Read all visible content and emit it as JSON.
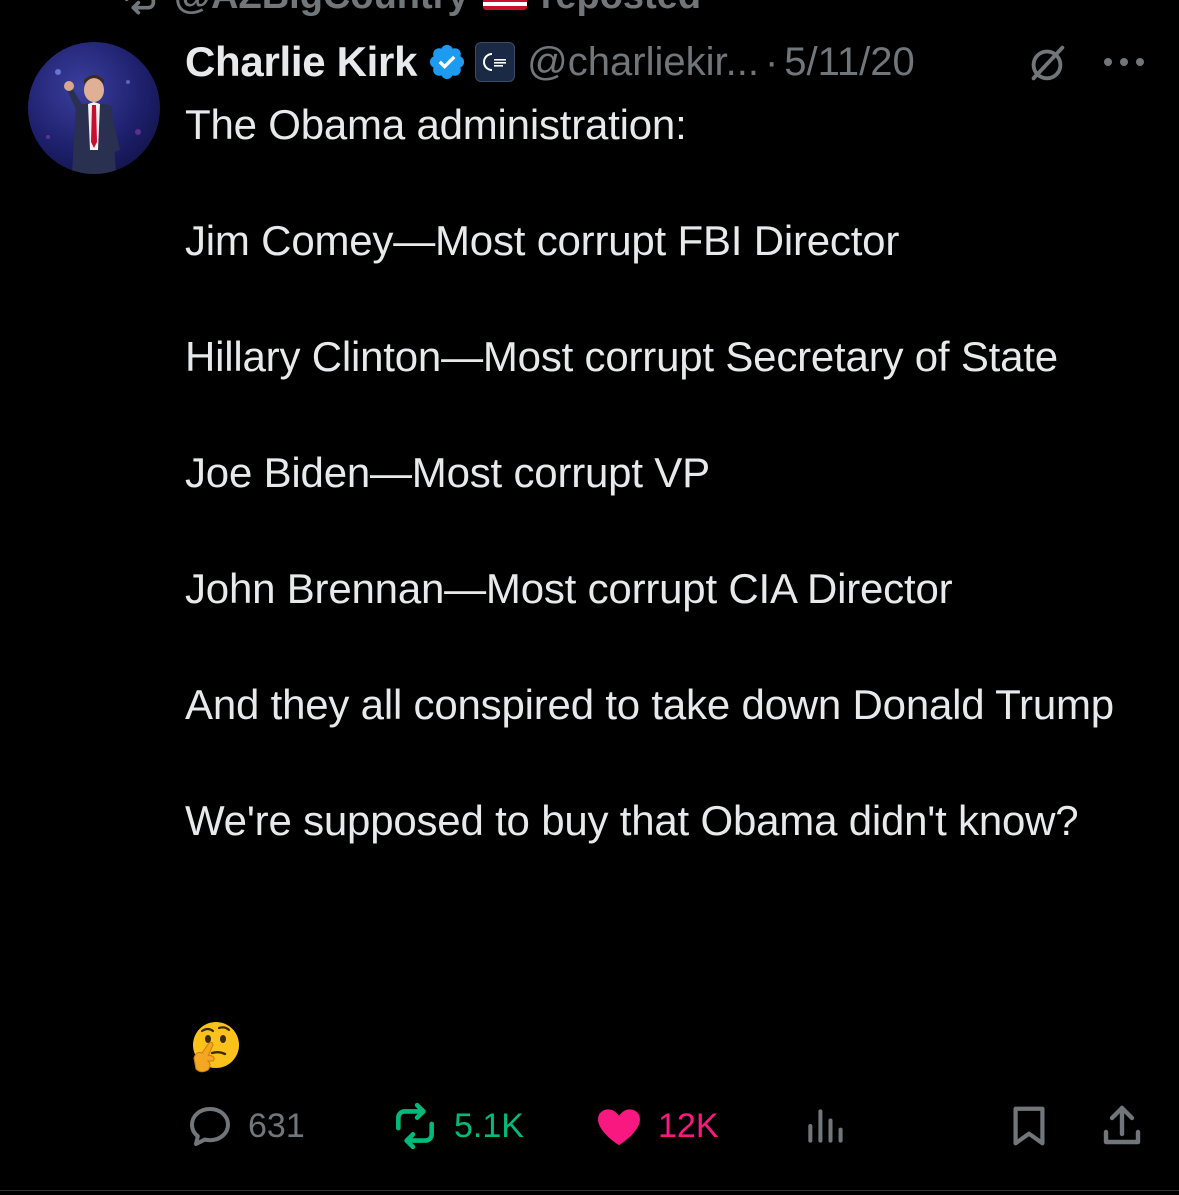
{
  "repost_banner": {
    "user": "@AZBigCountry",
    "text": "reposted"
  },
  "tweet": {
    "author_name": "Charlie Kirk",
    "handle": "@charliekir...",
    "separator": "·",
    "date": "5/11/20",
    "text": "The Obama administration:\n\nJim Comey—Most corrupt FBI Director\n\nHillary Clinton—Most corrupt Secretary of State\n\nJoe Biden—Most corrupt VP\n\nJohn Brennan—Most corrupt CIA Director\n\nAnd they all conspired to take down Donald Trump\n\nWe're supposed to buy that Obama didn't know?"
  },
  "actions": {
    "replies": "631",
    "reposts": "5.1K",
    "likes": "12K"
  },
  "icons": {
    "repost_banner": "repost-icon",
    "flag": "us-flag-icon",
    "verified": "verified-badge-icon",
    "affiliate": "turning-point-usa-badge-icon",
    "grok": "grok-icon",
    "more": "more-icon",
    "emoji": "thinking-face-emoji",
    "reply": "reply-icon",
    "repost": "repost-icon",
    "like": "heart-icon",
    "views": "views-icon",
    "bookmark": "bookmark-icon",
    "share": "share-icon"
  },
  "colors": {
    "background": "#000000",
    "text": "#e7e9ea",
    "secondary": "#71767b",
    "verified": "#1d9bf0",
    "repost_active": "#00ba7c",
    "like_active": "#f91880"
  }
}
